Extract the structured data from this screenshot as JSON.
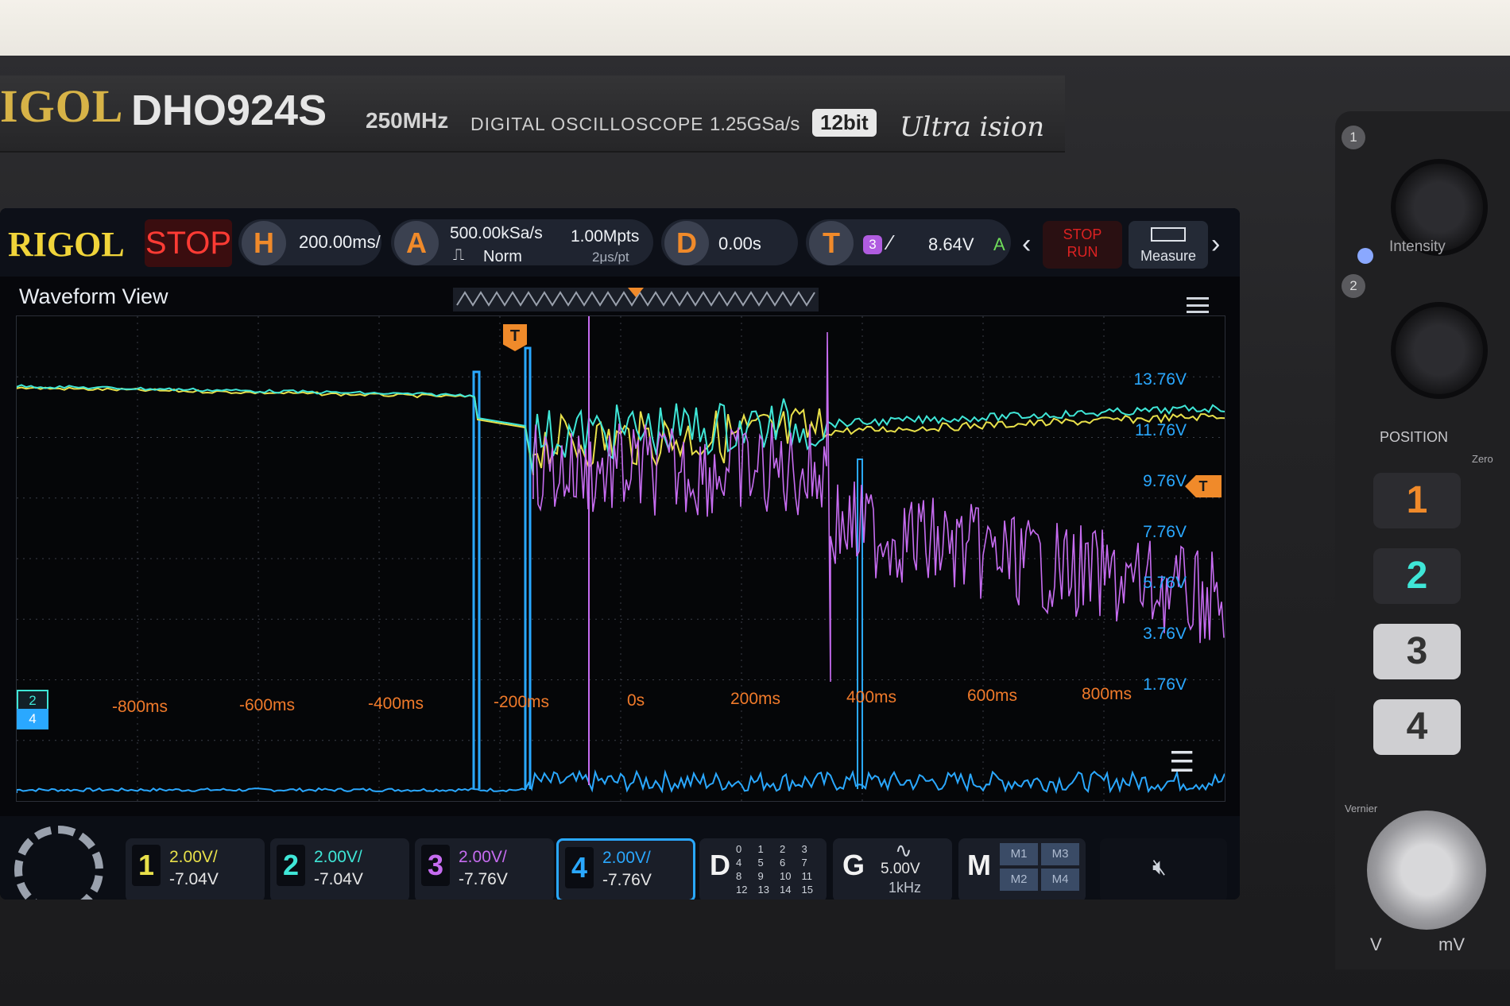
{
  "brand": {
    "logo": "IGOL",
    "model": "DHO924S",
    "bandwidth": "250MHz",
    "description": "DIGITAL OSCILLOSCOPE",
    "sample_rate": "1.25GSa/s",
    "bits": "12bit",
    "ultravision": "Ultra ision"
  },
  "topbar": {
    "logo": "RIGOL",
    "status": "STOP",
    "h_label": "H",
    "timebase": "200.00ms/",
    "a_label": "A",
    "acq_rate": "500.00kSa/s",
    "acq_mode": "Norm",
    "mem_depth": "1.00Mpts",
    "time_per_pt": "2μs/pt",
    "d_label": "D",
    "delay": "0.00s",
    "t_label": "T",
    "trig_source": "3",
    "trig_level": "8.64V",
    "trig_mode": "A",
    "stop_label": "STOP",
    "run_label": "RUN",
    "measure_label": "Measure"
  },
  "waveform": {
    "title": "Waveform View",
    "trigger_marker": "T",
    "y_labels": [
      "13.76V",
      "11.76V",
      "9.76V",
      "7.76V",
      "5.76V",
      "3.76V",
      "1.76V"
    ],
    "x_labels": [
      "-800ms",
      "-600ms",
      "-400ms",
      "-200ms",
      "0s",
      "200ms",
      "400ms",
      "600ms",
      "800ms"
    ],
    "ch_markers": [
      "2",
      "4"
    ],
    "colors": {
      "ch1": "#e8e04a",
      "ch2": "#3fe6d7",
      "ch3": "#c66cf0",
      "ch4": "#2aa8ff"
    }
  },
  "channels": [
    {
      "num": "1",
      "scale": "2.00V/",
      "offset": "-7.04V",
      "color": "#e8e04a"
    },
    {
      "num": "2",
      "scale": "2.00V/",
      "offset": "-7.04V",
      "color": "#3fe6d7"
    },
    {
      "num": "3",
      "scale": "2.00V/",
      "offset": "-7.76V",
      "color": "#c66cf0"
    },
    {
      "num": "4",
      "scale": "2.00V/",
      "offset": "-7.76V",
      "color": "#2aa8ff"
    }
  ],
  "digital": {
    "label": "D",
    "bits": [
      "0",
      "1",
      "2",
      "3",
      "4",
      "5",
      "6",
      "7",
      "8",
      "9",
      "10",
      "11",
      "12",
      "13",
      "14",
      "15"
    ]
  },
  "gen": {
    "label": "G",
    "amplitude": "5.00V",
    "freq": "1kHz"
  },
  "math": {
    "label": "M",
    "items": [
      "M1",
      "M3",
      "M2",
      "M4"
    ]
  },
  "panel": {
    "intensity": "Intensity",
    "position": "POSITION",
    "zero": "Zero",
    "buttons": [
      "1",
      "2",
      "3",
      "4"
    ],
    "vernier": "Vernier",
    "v_label": "V",
    "mv_label": "mV",
    "knob1": "1",
    "knob2": "2"
  }
}
